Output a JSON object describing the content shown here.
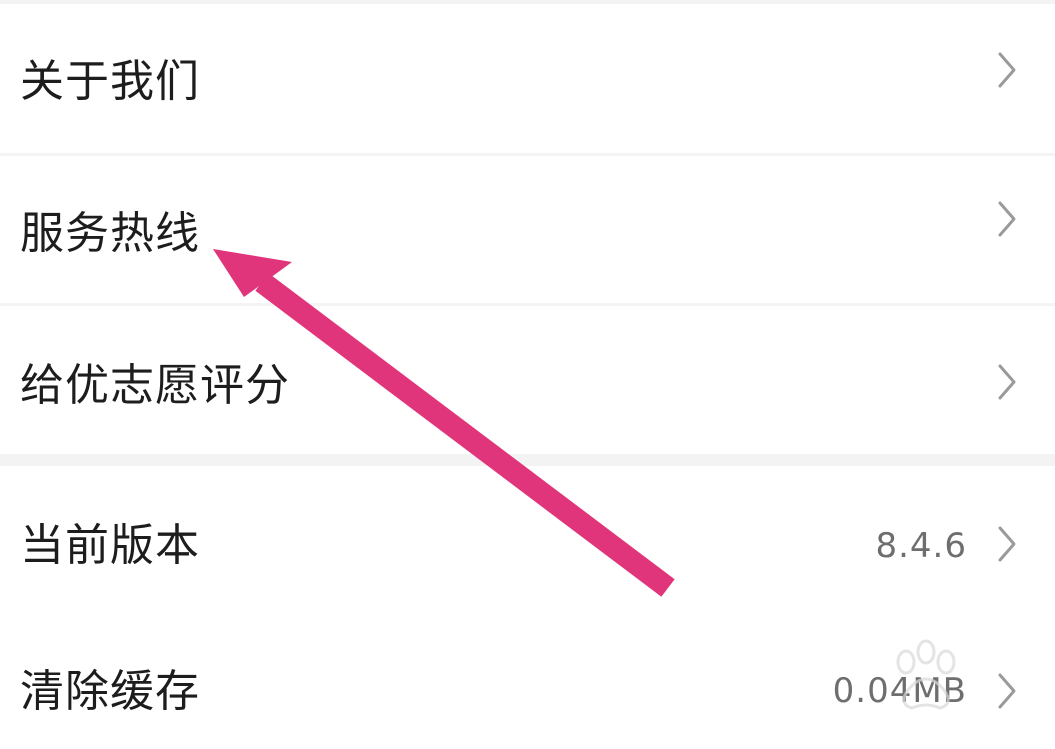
{
  "settings": {
    "items": [
      {
        "label": "关于我们",
        "value": ""
      },
      {
        "label": "服务热线",
        "value": ""
      },
      {
        "label": "给优志愿评分",
        "value": ""
      },
      {
        "label": "当前版本",
        "value": "8.4.6"
      },
      {
        "label": "清除缓存",
        "value": "0.04MB"
      }
    ]
  },
  "annotation": {
    "arrow_color": "#e0357a"
  },
  "icons": {
    "row_chevron": "chevron-right-icon",
    "watermark": "baidu-paw-icon"
  }
}
